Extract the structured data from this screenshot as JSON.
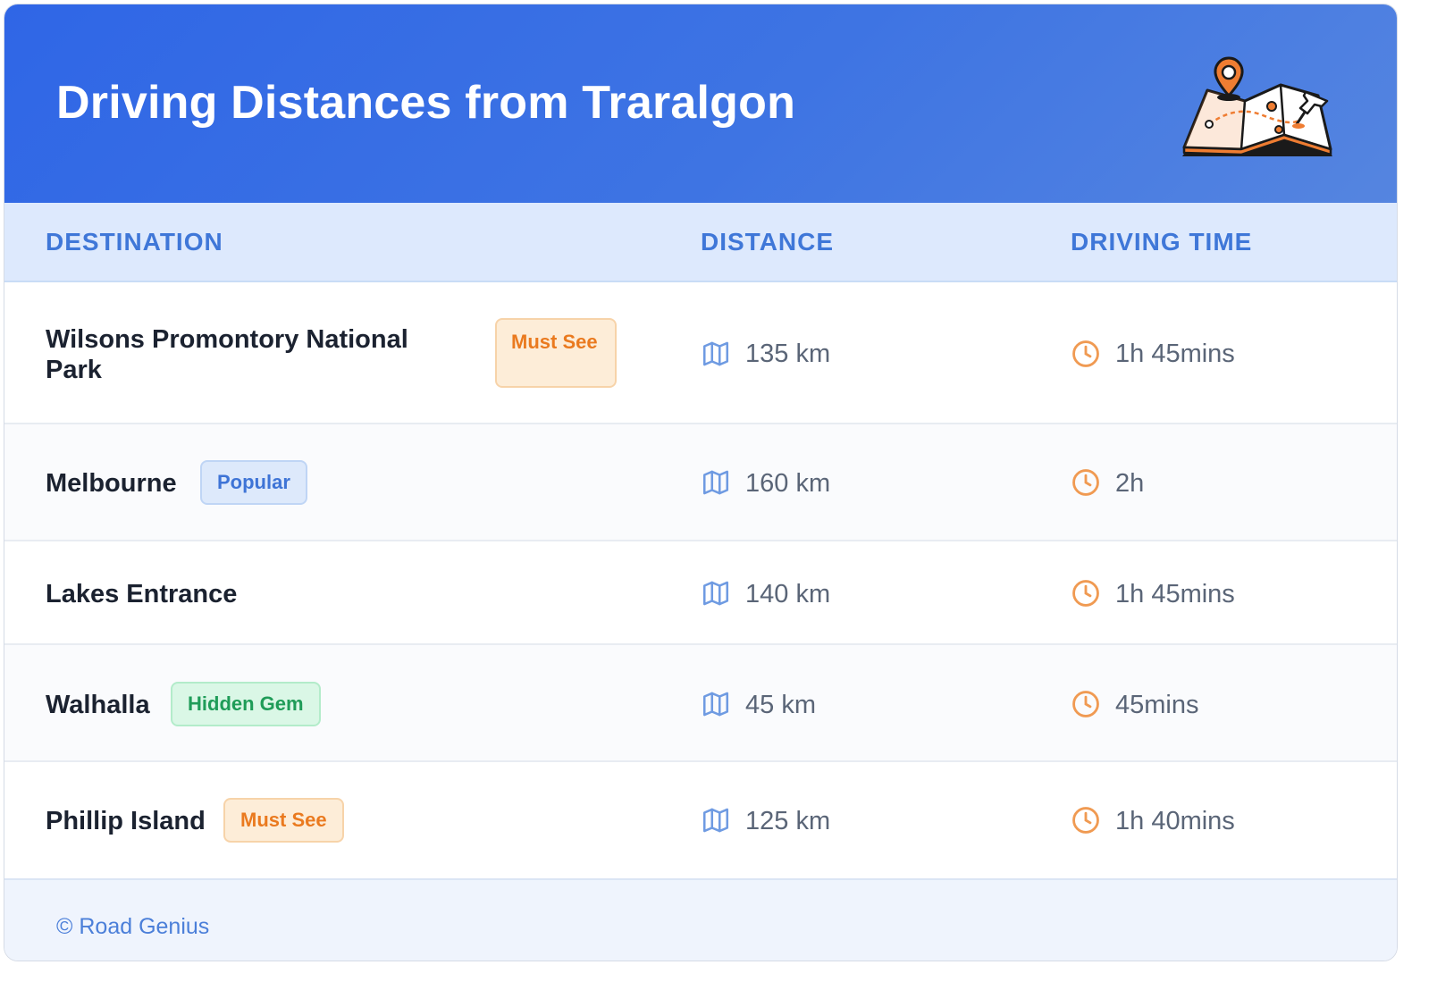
{
  "title": "Driving Distances from Traralgon",
  "header_icon": "map-pin-illustration",
  "columns": {
    "destination": "DESTINATION",
    "distance": "DISTANCE",
    "driving_time": "DRIVING TIME"
  },
  "rows": [
    {
      "destination": "Wilsons Promontory National Park",
      "badge": "Must See",
      "badge_type": "must-see",
      "distance": "135 km",
      "time": "1h 45mins"
    },
    {
      "destination": "Melbourne",
      "badge": "Popular",
      "badge_type": "popular",
      "distance": "160 km",
      "time": "2h"
    },
    {
      "destination": "Lakes Entrance",
      "badge": "",
      "badge_type": "",
      "distance": "140 km",
      "time": "1h 45mins"
    },
    {
      "destination": "Walhalla",
      "badge": "Hidden Gem",
      "badge_type": "hidden-gem",
      "distance": "45 km",
      "time": "45mins"
    },
    {
      "destination": "Phillip Island",
      "badge": "Must See",
      "badge_type": "must-see",
      "distance": "125 km",
      "time": "1h 40mins"
    }
  ],
  "icons": {
    "distance": "map-icon",
    "time": "clock-icon"
  },
  "colors": {
    "header": "#2f66e6",
    "accent_orange": "#ea7a1f",
    "accent_blue": "#3e74d6",
    "accent_green": "#1f9c58"
  },
  "footer": "© Road Genius"
}
